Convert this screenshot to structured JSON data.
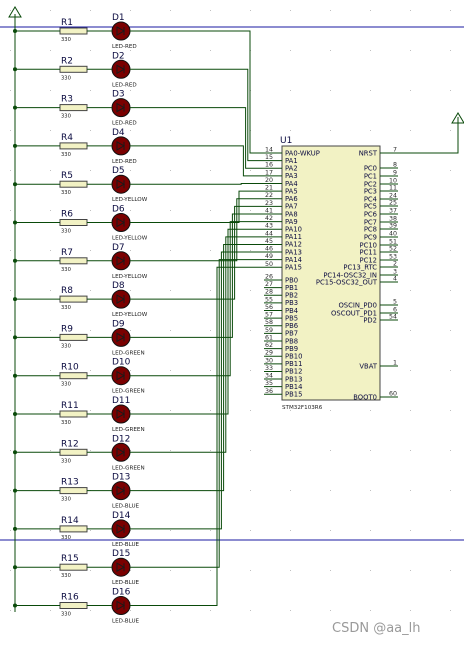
{
  "colors": {
    "wire": "#0a4a0a",
    "body_fill": "#f2f2c4",
    "body_stroke": "#444444",
    "text": "#0b0b40",
    "led_fill": "#7a0000",
    "grid_line": "#1818a0",
    "grid_dot": "#c0c0c0"
  },
  "mcu": {
    "ref": "U1",
    "part": "STM32F103R6",
    "left_pins": [
      {
        "num": "14",
        "name": "PA0-WKUP"
      },
      {
        "num": "15",
        "name": "PA1"
      },
      {
        "num": "16",
        "name": "PA2"
      },
      {
        "num": "17",
        "name": "PA3"
      },
      {
        "num": "20",
        "name": "PA4"
      },
      {
        "num": "21",
        "name": "PA5"
      },
      {
        "num": "22",
        "name": "PA6"
      },
      {
        "num": "23",
        "name": "PA7"
      },
      {
        "num": "41",
        "name": "PA8"
      },
      {
        "num": "42",
        "name": "PA9"
      },
      {
        "num": "43",
        "name": "PA10"
      },
      {
        "num": "44",
        "name": "PA11"
      },
      {
        "num": "45",
        "name": "PA12"
      },
      {
        "num": "46",
        "name": "PA13"
      },
      {
        "num": "49",
        "name": "PA14"
      },
      {
        "num": "50",
        "name": "PA15"
      },
      {
        "num": "26",
        "name": "PB0"
      },
      {
        "num": "27",
        "name": "PB1"
      },
      {
        "num": "28",
        "name": "PB2"
      },
      {
        "num": "55",
        "name": "PB3"
      },
      {
        "num": "56",
        "name": "PB4"
      },
      {
        "num": "57",
        "name": "PB5"
      },
      {
        "num": "58",
        "name": "PB6"
      },
      {
        "num": "59",
        "name": "PB7"
      },
      {
        "num": "61",
        "name": "PB8"
      },
      {
        "num": "62",
        "name": "PB9"
      },
      {
        "num": "29",
        "name": "PB10"
      },
      {
        "num": "30",
        "name": "PB11"
      },
      {
        "num": "33",
        "name": "PB12"
      },
      {
        "num": "34",
        "name": "PB13"
      },
      {
        "num": "35",
        "name": "PB14"
      },
      {
        "num": "36",
        "name": "PB15"
      }
    ],
    "right_pins": [
      {
        "num": "7",
        "name": "NRST"
      },
      {
        "num": "8",
        "name": "PC0"
      },
      {
        "num": "9",
        "name": "PC1"
      },
      {
        "num": "10",
        "name": "PC2"
      },
      {
        "num": "11",
        "name": "PC3"
      },
      {
        "num": "24",
        "name": "PC4"
      },
      {
        "num": "25",
        "name": "PC5"
      },
      {
        "num": "37",
        "name": "PC6"
      },
      {
        "num": "38",
        "name": "PC7"
      },
      {
        "num": "39",
        "name": "PC8"
      },
      {
        "num": "40",
        "name": "PC9"
      },
      {
        "num": "51",
        "name": "PC10"
      },
      {
        "num": "52",
        "name": "PC11"
      },
      {
        "num": "53",
        "name": "PC12"
      },
      {
        "num": "2",
        "name": "PC13_RTC"
      },
      {
        "num": "3",
        "name": "PC14-OSC32_IN"
      },
      {
        "num": "4",
        "name": "PC15-OSC32_OUT"
      },
      {
        "num": "5",
        "name": "OSCIN_PD0"
      },
      {
        "num": "6",
        "name": "OSCOUT_PD1"
      },
      {
        "num": "54",
        "name": "PD2"
      },
      {
        "num": "1",
        "name": "VBAT"
      },
      {
        "num": "60",
        "name": "BOOT0"
      }
    ]
  },
  "channels": [
    {
      "res": "R1",
      "rval": "330",
      "led": "D1",
      "ltype": "LED-RED"
    },
    {
      "res": "R2",
      "rval": "330",
      "led": "D2",
      "ltype": "LED-RED"
    },
    {
      "res": "R3",
      "rval": "330",
      "led": "D3",
      "ltype": "LED-RED"
    },
    {
      "res": "R4",
      "rval": "330",
      "led": "D4",
      "ltype": "LED-RED"
    },
    {
      "res": "R5",
      "rval": "330",
      "led": "D5",
      "ltype": "LED-YELLOW"
    },
    {
      "res": "R6",
      "rval": "330",
      "led": "D6",
      "ltype": "LED-YELLOW"
    },
    {
      "res": "R7",
      "rval": "330",
      "led": "D7",
      "ltype": "LED-YELLOW"
    },
    {
      "res": "R8",
      "rval": "330",
      "led": "D8",
      "ltype": "LED-YELLOW"
    },
    {
      "res": "R9",
      "rval": "330",
      "led": "D9",
      "ltype": "LED-GREEN"
    },
    {
      "res": "R10",
      "rval": "330",
      "led": "D10",
      "ltype": "LED-GREEN"
    },
    {
      "res": "R11",
      "rval": "330",
      "led": "D11",
      "ltype": "LED-GREEN"
    },
    {
      "res": "R12",
      "rval": "330",
      "led": "D12",
      "ltype": "LED-GREEN"
    },
    {
      "res": "R13",
      "rval": "330",
      "led": "D13",
      "ltype": "LED-BLUE"
    },
    {
      "res": "R14",
      "rval": "330",
      "led": "D14",
      "ltype": "LED-BLUE"
    },
    {
      "res": "R15",
      "rval": "330",
      "led": "D15",
      "ltype": "LED-BLUE"
    },
    {
      "res": "R16",
      "rval": "330",
      "led": "D16",
      "ltype": "LED-BLUE"
    }
  ],
  "watermark": "CSDN @aa_lh"
}
